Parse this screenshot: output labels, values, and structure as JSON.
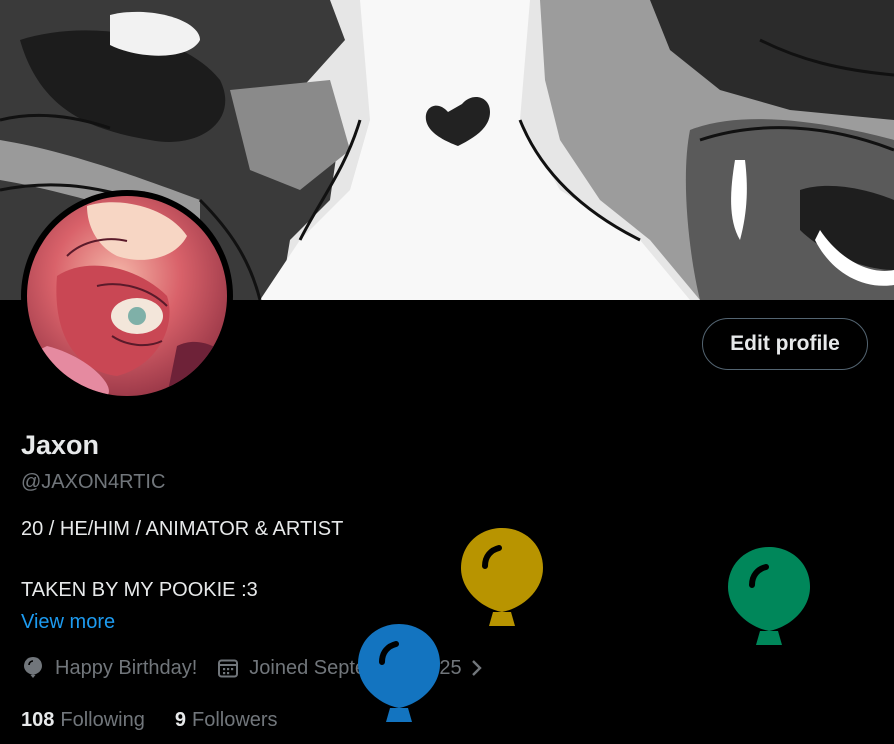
{
  "profile": {
    "display_name": "Jaxon",
    "handle": "@JAXON4RTIC",
    "bio_line_1": "20 / HE/HIM / ANIMATOR & ARTIST",
    "bio_line_2": "TAKEN BY MY POOKIE :3",
    "view_more_label": "View more",
    "birthday_text": "Happy Birthday!",
    "joined_text": "Joined September 2025",
    "following_count": "108",
    "following_label": "Following",
    "followers_count": "9",
    "followers_label": "Followers"
  },
  "actions": {
    "edit_profile_label": "Edit profile"
  },
  "icons": {
    "birthday": "balloon-icon",
    "joined": "calendar-icon",
    "joined_more": "chevron-right-icon"
  },
  "balloons": [
    {
      "color": "#b89400"
    },
    {
      "color": "#00875a"
    },
    {
      "color": "#1374c0"
    }
  ],
  "colors": {
    "background": "#000000",
    "primary_text": "#e7e9ea",
    "secondary_text": "#71767b",
    "link": "#1d9bf0",
    "button_border": "#536471"
  }
}
